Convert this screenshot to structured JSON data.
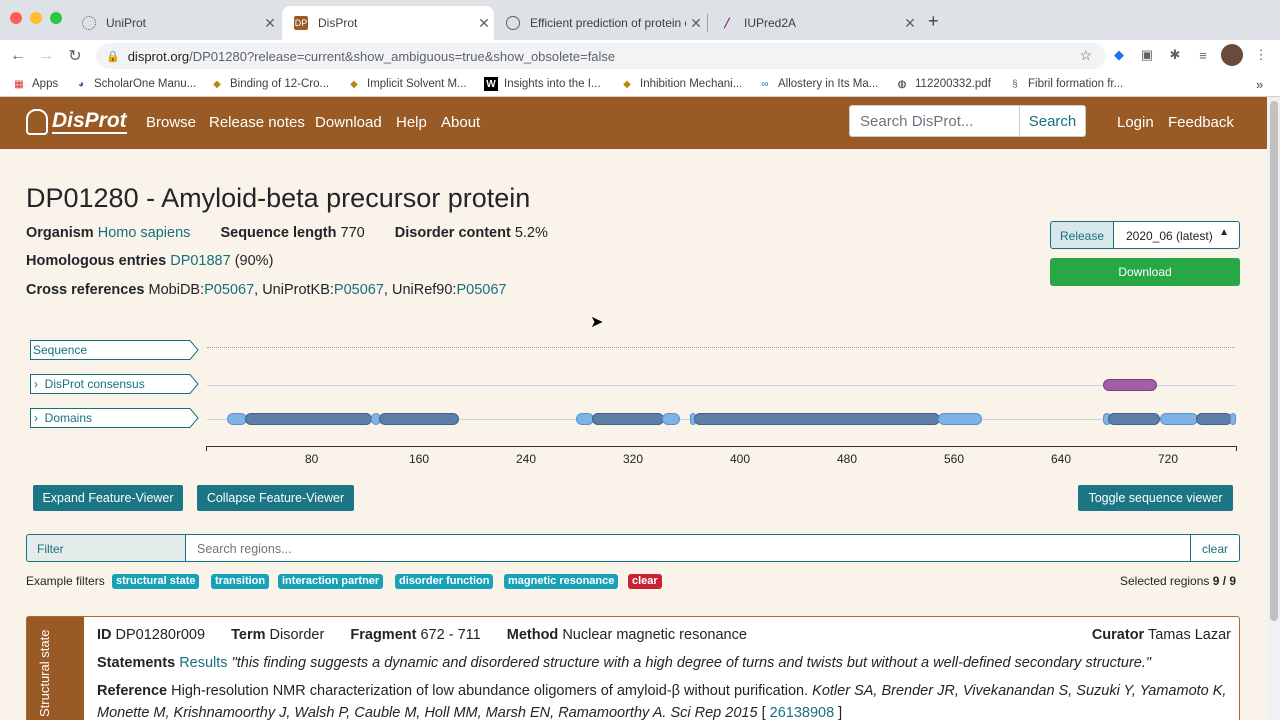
{
  "browser": {
    "tabs": [
      {
        "title": "UniProt",
        "active": false
      },
      {
        "title": "DisProt",
        "active": true
      },
      {
        "title": "Efficient prediction of protein d",
        "active": false
      },
      {
        "title": "IUPred2A",
        "active": false
      }
    ],
    "url_host": "disprot.org",
    "url_path": "/DP01280?release=current&show_ambiguous=true&show_obsolete=false",
    "bookmarks": [
      {
        "label": "Apps",
        "icon": "apps-grid-icon"
      },
      {
        "label": "ScholarOne Manu...",
        "icon": "scholarone-icon"
      },
      {
        "label": "Binding of 12-Cro...",
        "icon": "journal-icon"
      },
      {
        "label": "Implicit Solvent M...",
        "icon": "journal-icon"
      },
      {
        "label": "Insights into the I...",
        "icon": "wiley-icon"
      },
      {
        "label": "Inhibition Mechani...",
        "icon": "journal-icon"
      },
      {
        "label": "Allostery in Its Ma...",
        "icon": "link-icon"
      },
      {
        "label": "112200332.pdf",
        "icon": "globe-icon"
      },
      {
        "label": "Fibril formation fr...",
        "icon": "doc-icon"
      }
    ],
    "bookmarks_more": "»"
  },
  "site": {
    "logo": "DisProt",
    "nav": [
      "Browse",
      "Release notes",
      "Download",
      "Help",
      "About"
    ],
    "search_placeholder": "Search DisProt...",
    "search_button": "Search",
    "login": "Login",
    "feedback": "Feedback"
  },
  "entry": {
    "title": "DP01280 - Amyloid-beta precursor protein",
    "organism_label": "Organism",
    "organism": "Homo sapiens",
    "seqlen_label": "Sequence length",
    "seqlen": "770",
    "disorder_label": "Disorder content",
    "disorder": "5.2%",
    "homologous_label": "Homologous entries",
    "homologous_id": "DP01887",
    "homologous_pct": "(90%)",
    "xref_label": "Cross references",
    "xref_mobidb_label": "MobiDB:",
    "xref_mobidb": "P05067",
    "xref_uniprot_label": ", UniProtKB:",
    "xref_uniprot": "P05067",
    "xref_uniref_label": ", UniRef90:",
    "xref_uniref": "P05067"
  },
  "release": {
    "label": "Release",
    "selected": "2020_06 (latest)",
    "download": "Download"
  },
  "viewer": {
    "tracks": [
      "Sequence",
      "DisProt consensus",
      "Domains"
    ],
    "ticks": [
      "80",
      "160",
      "240",
      "320",
      "400",
      "480",
      "560",
      "640",
      "720"
    ],
    "expand": "Expand Feature-Viewer",
    "collapse": "Collapse Feature-Viewer",
    "toggle_seq": "Toggle sequence viewer",
    "consensus_color": "#a45ea6",
    "domain_color": "#5b7fa6",
    "domain_light_color": "#7fb3e6"
  },
  "filter": {
    "label": "Filter",
    "placeholder": "Search regions...",
    "clear": "clear",
    "examples_label": "Example filters",
    "chips": [
      "structural state",
      "transition",
      "interaction partner",
      "disorder function",
      "magnetic resonance"
    ],
    "chip_clear": "clear",
    "selected_label": "Selected regions",
    "selected_value": "9 / 9"
  },
  "region": {
    "side_label": "Structural state",
    "id_label": "ID",
    "id": "DP01280r009",
    "term_label": "Term",
    "term": "Disorder",
    "fragment_label": "Fragment",
    "fragment": "672 - 711",
    "method_label": "Method",
    "method": "Nuclear magnetic resonance",
    "curator_label": "Curator",
    "curator": "Tamas Lazar",
    "statements_label": "Statements",
    "statements_link": "Results",
    "statement": "\"this finding suggests a dynamic and disordered structure with a high degree of turns and twists but without a well-defined secondary structure.\"",
    "reference_label": "Reference",
    "reference_title": "High-resolution NMR characterization of low abundance oligomers of amyloid-β without purification.",
    "reference_authors_1": "Kotler SA, Brender JR, Vivekanandan S, Suzuki Y, Yamamoto K,",
    "reference_authors_2": "Monette M, Krishnamoorthy J, Walsh P, Cauble M, Holl MM, Marsh EN, Ramamoorthy A. Sci Rep 2015",
    "pmid_open": "[",
    "pmid": "26138908",
    "pmid_close": "]"
  }
}
